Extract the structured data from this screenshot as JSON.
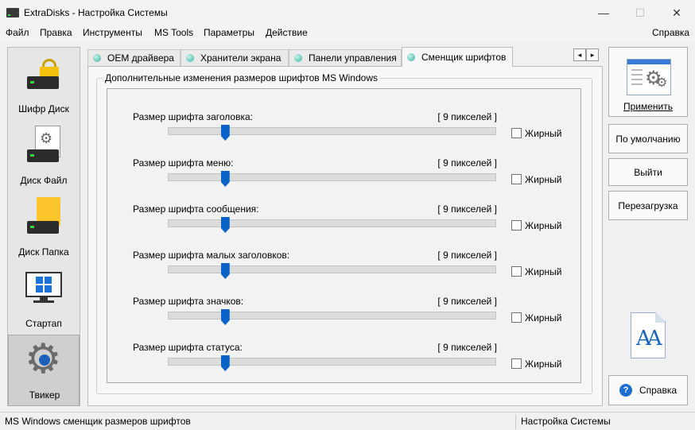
{
  "window": {
    "title": "ExtraDisks - Настройка Системы",
    "icon": "drive-icon",
    "controls": {
      "minimize": "—",
      "maximize": "☐",
      "close": "✕"
    }
  },
  "menu": {
    "items": [
      "Файл",
      "Правка",
      "Инструменты",
      "MS Tools",
      "Параметры",
      "Действие"
    ],
    "help": "Справка"
  },
  "leftnav": {
    "items": [
      {
        "label": "Шифр Диск",
        "icon": "lock-drive-icon"
      },
      {
        "label": "Диск Файл",
        "icon": "file-drive-icon"
      },
      {
        "label": "Диск Папка",
        "icon": "folder-drive-icon"
      },
      {
        "label": "Стартап",
        "icon": "windows-monitor-icon"
      },
      {
        "label": "Твикер",
        "icon": "gear-icon",
        "active": true
      }
    ]
  },
  "tabs": [
    {
      "label": "OEM драйвера"
    },
    {
      "label": "Хранители экрана"
    },
    {
      "label": "Панели управления"
    },
    {
      "label": "Сменщик шрифтов",
      "active": true
    }
  ],
  "tab_nav": {
    "prev": "◂",
    "next": "▸"
  },
  "panel": {
    "group_title": "Дополнительные изменения размеров шрифтов MS Windows",
    "rows": [
      {
        "label": "Размер шрифта заголовка:",
        "value": "[ 9 пикселей ]",
        "slider": 0.175,
        "bold_label": "Жирный",
        "bold": false
      },
      {
        "label": "Размер шрифта меню:",
        "value": "[ 9 пикселей ]",
        "slider": 0.175,
        "bold_label": "Жирный",
        "bold": false
      },
      {
        "label": "Размер шрифта сообщения:",
        "value": "[ 9 пикселей ]",
        "slider": 0.175,
        "bold_label": "Жирный",
        "bold": false
      },
      {
        "label": "Размер шрифта малых заголовков:",
        "value": "[ 9 пикселей ]",
        "slider": 0.175,
        "bold_label": "Жирный",
        "bold": false
      },
      {
        "label": "Размер шрифта значков:",
        "value": "[ 9 пикселей ]",
        "slider": 0.175,
        "bold_label": "Жирный",
        "bold": false
      },
      {
        "label": "Размер шрифта статуса:",
        "value": "[ 9 пикселей ]",
        "slider": 0.175,
        "bold_label": "Жирный",
        "bold": false
      }
    ]
  },
  "actions": {
    "apply": "Применить",
    "defaults": "По умолчанию",
    "exit": "Выйти",
    "reboot": "Перезагрузка",
    "help": "Справка",
    "help_icon": "?"
  },
  "font_icon": {
    "text": "AA"
  },
  "status": {
    "left": "MS Windows сменщик размеров шрифтов",
    "right": "Настройка Системы"
  },
  "colors": {
    "accent": "#0a64c8",
    "tab_dot": "#38b3a0",
    "drive_led": "#3bd23b"
  }
}
